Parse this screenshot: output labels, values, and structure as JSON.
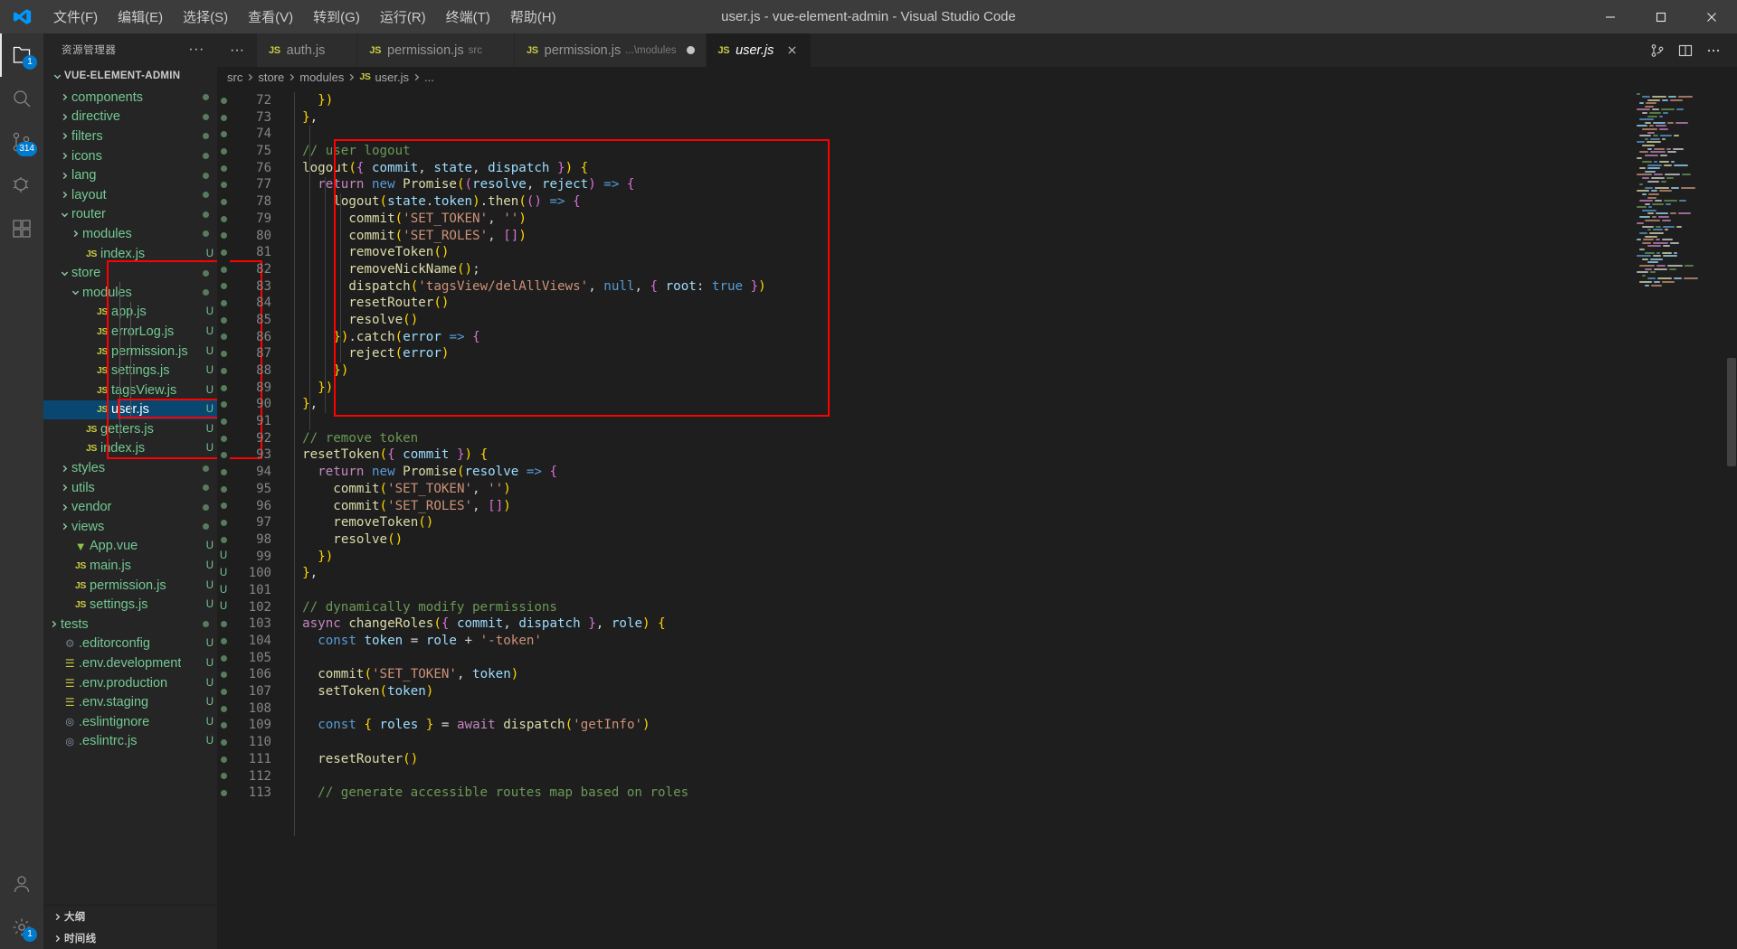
{
  "window": {
    "title": "user.js - vue-element-admin - Visual Studio Code",
    "menus": [
      {
        "label": "文件(F)",
        "name": "menu-file"
      },
      {
        "label": "编辑(E)",
        "name": "menu-edit"
      },
      {
        "label": "选择(S)",
        "name": "menu-selection"
      },
      {
        "label": "查看(V)",
        "name": "menu-view"
      },
      {
        "label": "转到(G)",
        "name": "menu-go"
      },
      {
        "label": "运行(R)",
        "name": "menu-run"
      },
      {
        "label": "终端(T)",
        "name": "menu-terminal"
      },
      {
        "label": "帮助(H)",
        "name": "menu-help"
      }
    ],
    "controls": {
      "minimize": "minimize",
      "maximize": "maximize",
      "close": "close"
    }
  },
  "activitybar": {
    "items": [
      {
        "icon": "files-icon",
        "name": "activity-explorer",
        "badge": "1",
        "active": true
      },
      {
        "icon": "search-icon",
        "name": "activity-search",
        "badge": "",
        "active": false
      },
      {
        "icon": "source-control-icon",
        "name": "activity-source-control",
        "badge": "314",
        "active": false
      },
      {
        "icon": "debug-icon",
        "name": "activity-run-debug",
        "badge": "",
        "active": false
      },
      {
        "icon": "extensions-icon",
        "name": "activity-extensions",
        "badge": "",
        "active": false
      }
    ],
    "bottom": [
      {
        "icon": "account-icon",
        "name": "activity-account",
        "badge": ""
      },
      {
        "icon": "gear-icon",
        "name": "activity-settings",
        "badge": "1"
      }
    ]
  },
  "sidebar": {
    "header": "资源管理器",
    "more_actions": "···",
    "project": "VUE-ELEMENT-ADMIN",
    "bottom_sections": [
      {
        "label": "大纲",
        "name": "sidebar-section-outline"
      },
      {
        "label": "时间线",
        "name": "sidebar-section-timeline"
      }
    ],
    "tree": [
      {
        "label": "components",
        "type": "folder",
        "expanded": false,
        "indent": 1,
        "status": "",
        "dot": true
      },
      {
        "label": "directive",
        "type": "folder",
        "expanded": false,
        "indent": 1,
        "status": "",
        "dot": true
      },
      {
        "label": "filters",
        "type": "folder",
        "expanded": false,
        "indent": 1,
        "status": "",
        "dot": true
      },
      {
        "label": "icons",
        "type": "folder",
        "expanded": false,
        "indent": 1,
        "status": "",
        "dot": true
      },
      {
        "label": "lang",
        "type": "folder",
        "expanded": false,
        "indent": 1,
        "status": "",
        "dot": true
      },
      {
        "label": "layout",
        "type": "folder",
        "expanded": false,
        "indent": 1,
        "status": "",
        "dot": true
      },
      {
        "label": "router",
        "type": "folder",
        "expanded": true,
        "indent": 1,
        "status": "",
        "dot": true
      },
      {
        "label": "modules",
        "type": "folder",
        "expanded": false,
        "indent": 2,
        "status": "",
        "dot": true
      },
      {
        "label": "index.js",
        "type": "js",
        "expanded": false,
        "indent": 2,
        "status": "U",
        "dot": false
      },
      {
        "label": "store",
        "type": "folder",
        "expanded": true,
        "indent": 1,
        "status": "",
        "dot": true
      },
      {
        "label": "modules",
        "type": "folder",
        "expanded": true,
        "indent": 2,
        "status": "",
        "dot": true
      },
      {
        "label": "app.js",
        "type": "js",
        "expanded": false,
        "indent": 3,
        "status": "U",
        "dot": false
      },
      {
        "label": "errorLog.js",
        "type": "js",
        "expanded": false,
        "indent": 3,
        "status": "U",
        "dot": false
      },
      {
        "label": "permission.js",
        "type": "js",
        "expanded": false,
        "indent": 3,
        "status": "U",
        "dot": false
      },
      {
        "label": "settings.js",
        "type": "js",
        "expanded": false,
        "indent": 3,
        "status": "U",
        "dot": false
      },
      {
        "label": "tagsView.js",
        "type": "js",
        "expanded": false,
        "indent": 3,
        "status": "U",
        "dot": false
      },
      {
        "label": "user.js",
        "type": "js",
        "expanded": false,
        "indent": 3,
        "status": "U",
        "dot": false,
        "selected": true
      },
      {
        "label": "getters.js",
        "type": "js",
        "expanded": false,
        "indent": 2,
        "status": "U",
        "dot": false
      },
      {
        "label": "index.js",
        "type": "js",
        "expanded": false,
        "indent": 2,
        "status": "U",
        "dot": false
      },
      {
        "label": "styles",
        "type": "folder",
        "expanded": false,
        "indent": 1,
        "status": "",
        "dot": true
      },
      {
        "label": "utils",
        "type": "folder",
        "expanded": false,
        "indent": 1,
        "status": "",
        "dot": true
      },
      {
        "label": "vendor",
        "type": "folder",
        "expanded": false,
        "indent": 1,
        "status": "",
        "dot": true
      },
      {
        "label": "views",
        "type": "folder",
        "expanded": false,
        "indent": 1,
        "status": "",
        "dot": true
      },
      {
        "label": "App.vue",
        "type": "vue",
        "expanded": false,
        "indent": 1,
        "status": "U",
        "dot": false
      },
      {
        "label": "main.js",
        "type": "js",
        "expanded": false,
        "indent": 1,
        "status": "U",
        "dot": false
      },
      {
        "label": "permission.js",
        "type": "js",
        "expanded": false,
        "indent": 1,
        "status": "U",
        "dot": false
      },
      {
        "label": "settings.js",
        "type": "js",
        "expanded": false,
        "indent": 1,
        "status": "U",
        "dot": false
      },
      {
        "label": "tests",
        "type": "folder",
        "expanded": false,
        "indent": 0,
        "status": "",
        "dot": true
      },
      {
        "label": ".editorconfig",
        "type": "gear",
        "expanded": false,
        "indent": 0,
        "status": "U",
        "dot": false
      },
      {
        "label": ".env.development",
        "type": "env",
        "expanded": false,
        "indent": 0,
        "status": "U",
        "dot": false
      },
      {
        "label": ".env.production",
        "type": "env",
        "expanded": false,
        "indent": 0,
        "status": "U",
        "dot": false
      },
      {
        "label": ".env.staging",
        "type": "env",
        "expanded": false,
        "indent": 0,
        "status": "U",
        "dot": false
      },
      {
        "label": ".eslintignore",
        "type": "eslint",
        "expanded": false,
        "indent": 0,
        "status": "U",
        "dot": false
      },
      {
        "label": ".eslintrc.js",
        "type": "eslint",
        "expanded": false,
        "indent": 0,
        "status": "U",
        "dot": false
      }
    ]
  },
  "tabs": [
    {
      "label": "auth.js",
      "sub": "",
      "icon": "js-icon",
      "active": false,
      "dirty": false,
      "closable": false
    },
    {
      "label": "permission.js",
      "sub": "src",
      "icon": "js-icon",
      "active": false,
      "dirty": false,
      "closable": false
    },
    {
      "label": "permission.js",
      "sub": "...\\modules",
      "icon": "js-icon",
      "active": false,
      "dirty": true,
      "closable": false
    },
    {
      "label": "user.js",
      "sub": "",
      "icon": "js-icon",
      "active": true,
      "dirty": false,
      "closable": true
    }
  ],
  "tab_overflow": "···",
  "editor_actions": [
    {
      "name": "split-editor-right-icon"
    },
    {
      "name": "open-changes-icon"
    },
    {
      "name": "more-actions-icon"
    }
  ],
  "breadcrumb": [
    "src",
    "store",
    "modules",
    "user.js",
    "..."
  ],
  "code": {
    "first_line": 72,
    "lines": [
      {
        "n": 72,
        "git": "dot",
        "text": "    })"
      },
      {
        "n": 73,
        "git": "dot",
        "text": "  },"
      },
      {
        "n": 74,
        "git": "dot",
        "text": ""
      },
      {
        "n": 75,
        "git": "dot",
        "text": "  // user logout"
      },
      {
        "n": 76,
        "git": "dot",
        "text": "  logout({ commit, state, dispatch }) {"
      },
      {
        "n": 77,
        "git": "dot",
        "text": "    return new Promise((resolve, reject) => {"
      },
      {
        "n": 78,
        "git": "dot",
        "text": "      logout(state.token).then(() => {"
      },
      {
        "n": 79,
        "git": "dot",
        "text": "        commit('SET_TOKEN', '')"
      },
      {
        "n": 80,
        "git": "dot",
        "text": "        commit('SET_ROLES', [])"
      },
      {
        "n": 81,
        "git": "dot",
        "text": "        removeToken()"
      },
      {
        "n": 82,
        "git": "dot",
        "text": "        removeNickName();"
      },
      {
        "n": 83,
        "git": "dot",
        "text": "        dispatch('tagsView/delAllViews', null, { root: true })"
      },
      {
        "n": 84,
        "git": "dot",
        "text": "        resetRouter()"
      },
      {
        "n": 85,
        "git": "dot",
        "text": "        resolve()"
      },
      {
        "n": 86,
        "git": "dot",
        "text": "      }).catch(error => {"
      },
      {
        "n": 87,
        "git": "dot",
        "text": "        reject(error)"
      },
      {
        "n": 88,
        "git": "dot",
        "text": "      })"
      },
      {
        "n": 89,
        "git": "dot",
        "text": "    })"
      },
      {
        "n": 90,
        "git": "dot",
        "text": "  },"
      },
      {
        "n": 91,
        "git": "dot",
        "text": ""
      },
      {
        "n": 92,
        "git": "dot",
        "text": "  // remove token"
      },
      {
        "n": 93,
        "git": "dot",
        "text": "  resetToken({ commit }) {"
      },
      {
        "n": 94,
        "git": "dot",
        "text": "    return new Promise(resolve => {"
      },
      {
        "n": 95,
        "git": "dot",
        "text": "      commit('SET_TOKEN', '')"
      },
      {
        "n": 96,
        "git": "dot",
        "text": "      commit('SET_ROLES', [])"
      },
      {
        "n": 97,
        "git": "dot",
        "text": "      removeToken()"
      },
      {
        "n": 98,
        "git": "dot",
        "text": "      resolve()"
      },
      {
        "n": 99,
        "git": "U",
        "text": "    })"
      },
      {
        "n": 100,
        "git": "U",
        "text": "  },"
      },
      {
        "n": 101,
        "git": "U",
        "text": ""
      },
      {
        "n": 102,
        "git": "U",
        "text": "  // dynamically modify permissions"
      },
      {
        "n": 103,
        "git": "dot",
        "text": "  async changeRoles({ commit, dispatch }, role) {"
      },
      {
        "n": 104,
        "git": "dot",
        "text": "    const token = role + '-token'"
      },
      {
        "n": 105,
        "git": "dot",
        "text": ""
      },
      {
        "n": 106,
        "git": "dot",
        "text": "    commit('SET_TOKEN', token)"
      },
      {
        "n": 107,
        "git": "dot",
        "text": "    setToken(token)"
      },
      {
        "n": 108,
        "git": "dot",
        "text": ""
      },
      {
        "n": 109,
        "git": "dot",
        "text": "    const { roles } = await dispatch('getInfo')"
      },
      {
        "n": 110,
        "git": "dot",
        "text": ""
      },
      {
        "n": 111,
        "git": "dot",
        "text": "    resetRouter()"
      },
      {
        "n": 112,
        "git": "dot",
        "text": ""
      },
      {
        "n": 113,
        "git": "dot",
        "text": "    // generate accessible routes map based on roles"
      }
    ]
  },
  "annotations": {
    "color": "#ff0000",
    "regions": [
      {
        "name": "store-tree-highlight"
      },
      {
        "name": "user-js-row-highlight"
      },
      {
        "name": "logout-code-block-highlight"
      }
    ]
  }
}
